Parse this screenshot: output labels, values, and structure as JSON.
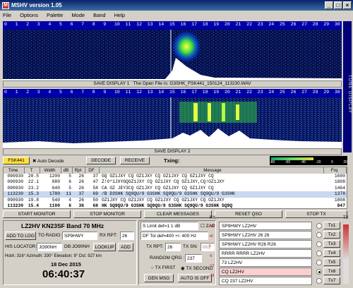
{
  "window": {
    "title": "MSHV version 1.05",
    "minimize": "_",
    "maximize": "□",
    "close": "×"
  },
  "menu": [
    "File",
    "Options",
    "Palette",
    "Mode",
    "Band",
    "Help"
  ],
  "ruler_ticks": [
    "0",
    "1",
    "2",
    "3",
    "4",
    "5",
    "6",
    "7",
    "8",
    "9",
    "10",
    "11",
    "12",
    "13",
    "14",
    "15",
    "16",
    "17",
    "18",
    "19",
    "20",
    "21",
    "22",
    "23",
    "24",
    "25",
    "26",
    "27",
    "28",
    "29",
    "30"
  ],
  "display1": {
    "save_label": "SAVE DISPLAY 1",
    "file_info": "The Open File Is:  G3SHK_FSK441_150124_113230.WAV"
  },
  "display2": {
    "save_label": "SAVE DISPLAY 2"
  },
  "tune_display": "TUNE DISPLAY",
  "controls": {
    "mode": "FSK441",
    "auto_decode": "Auto Decode",
    "decode": "DECODE",
    "receive": "RECEIVE",
    "txing": "Txing:",
    "meter_ticks": [
      "-80",
      "-60",
      "-40",
      "-20",
      "0",
      "20"
    ]
  },
  "table": {
    "headers": [
      "Time",
      "T",
      "Width",
      "dB",
      "Rpt",
      "DF",
      "Message",
      "Frq"
    ],
    "rows": [
      [
        "090930",
        "20.5",
        "1200",
        "5",
        "26",
        "37",
        "GQ OZ1JXY CQ OZ1JXY CQ OZ1JXY CQ OZ1JXY CQ",
        "1600"
      ],
      [
        "090930",
        "22.1",
        "880",
        "6",
        "26",
        "47",
        "Z!O*1JXYGQOZ1JXY CQ OZ1JXY CQ OZ1JXY,CQ!OZ1JXY",
        "1808"
      ],
      [
        "090930",
        "23.2",
        "640",
        "5",
        "26",
        "58",
        "CA OZ JEY3CQ OZ1JXY CQ OZ1JXY CQ OZ1JXY CQ",
        "1464"
      ],
      [
        "113230",
        "15.3",
        "1780",
        "11",
        "37",
        "69",
        "/B D3SHK SQ9QU/9 G3SHK SQ9QU/9 G3SHK SQ9QU/9 G3SHK",
        "1378"
      ],
      [
        "090930",
        "19.8",
        "540",
        "4",
        "26",
        "50",
        "OZ1JXY CQ OZ1JXY CQ OZ1JXY CQ OZ1JXY CQ OZ1JXY",
        "1808"
      ],
      [
        "113230",
        "15.4",
        "1100",
        "6",
        "36",
        "68",
        "HK SQ9QU/9 G3SHK SQ9QU/9 G3SHK SQ9QU/9 G3SHK SQ9Q",
        "947"
      ]
    ]
  },
  "buttons": {
    "start": "START MONITOR",
    "stop": "STOP MONITOR",
    "clear": "CLEAR MESSAGES",
    "reset": "RESET QSO",
    "stoptx": "STOP TX"
  },
  "station": {
    "call_band": "LZ2HV KN23SF   Band 70 MHz",
    "add_log": "ADD TO LOG",
    "to_radio_lbl": "TO RADIO:",
    "to_radio": "SP9HWY",
    "rx_rpt_lbl": "RX RPT:",
    "rx_rpt": "26",
    "his_loc_lbl": "HIS LOCATOR:",
    "his_loc": "JO90NH",
    "db": "DB:JO90NH",
    "lookup": "LOOKUP",
    "add": "ADD",
    "hot": "HotA: 316°  Azimuth: 330°  Elevation: 9°  Dst: 927 km",
    "date": "18 Dec 2015",
    "time": "06:40:37"
  },
  "settings": {
    "s_limit": "S Limit def=1  1  dB",
    "zap": "ZAP",
    "df_tol": "DF Tol def=400 +/-  400 Hz",
    "tx_rpt_lbl": "TX RPT:",
    "tx_rpt": "26",
    "tx_sn_lbl": "TX SN:",
    "tx_sn": "001",
    "random_qrg_lbl": "RANDOM QRG :",
    "random_qrg": "237",
    "tx_first": "TX FIRST",
    "tx_second": "TX SECOND",
    "gen_msg": "GEN MSG",
    "auto_off": "AUTO IS OFF"
  },
  "tx_side": {
    "rx": "RX",
    "tx": "TX",
    "db_labels": [
      "+12",
      "+6",
      "0",
      "-6",
      "-12",
      "-18"
    ]
  },
  "tx_messages": [
    {
      "text": "SP9HWY LZ2HV",
      "btn": "Tx1"
    },
    {
      "text": "SP9HWY LZ2HV 26 26",
      "btn": "Tx2"
    },
    {
      "text": "SP9HWY LZ2HV R26 R26",
      "btn": "Tx3"
    },
    {
      "text": "RRRR RRRR LZ2HV",
      "btn": "Tx4"
    },
    {
      "text": "73 LZ2HV",
      "btn": "Tx5"
    },
    {
      "text": "CQ LZ2HV",
      "btn": "Tx6"
    },
    {
      "text": "CQ 237 LZ2HV",
      "btn": "Tx7"
    }
  ],
  "colors": {
    "title": "#0a246a",
    "waterfall_bg": "#00002a",
    "mode_bg": "#ffe040",
    "highlight": "#f8d0d0"
  }
}
